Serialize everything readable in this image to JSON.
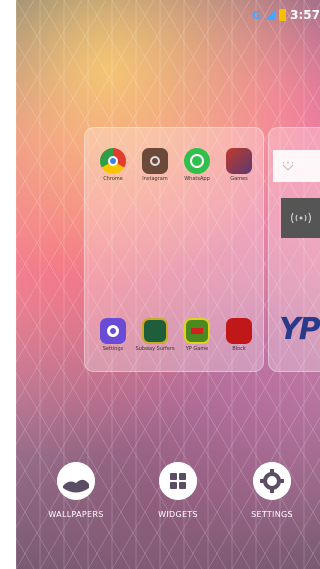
{
  "status": {
    "network": "G",
    "time": "3:57"
  },
  "page1_apps": {
    "top": [
      {
        "label": "Chrome",
        "icon": "chrome-icon"
      },
      {
        "label": "Instagram",
        "icon": "instagram-icon"
      },
      {
        "label": "WhatsApp",
        "icon": "whatsapp-icon"
      },
      {
        "label": "Games",
        "icon": "game-icon"
      }
    ],
    "bottom": [
      {
        "label": "Settings",
        "icon": "settings-icon"
      },
      {
        "label": "Subway Surfers",
        "icon": "subway-icon"
      },
      {
        "label": "YP Game",
        "icon": "yp-icon"
      },
      {
        "label": "Block",
        "icon": "block-icon"
      }
    ]
  },
  "page2": {
    "partial_logo_text": "YP"
  },
  "dock": {
    "wallpapers": "WALLPAPERS",
    "widgets": "WIDGETS",
    "settings": "SETTINGS"
  }
}
